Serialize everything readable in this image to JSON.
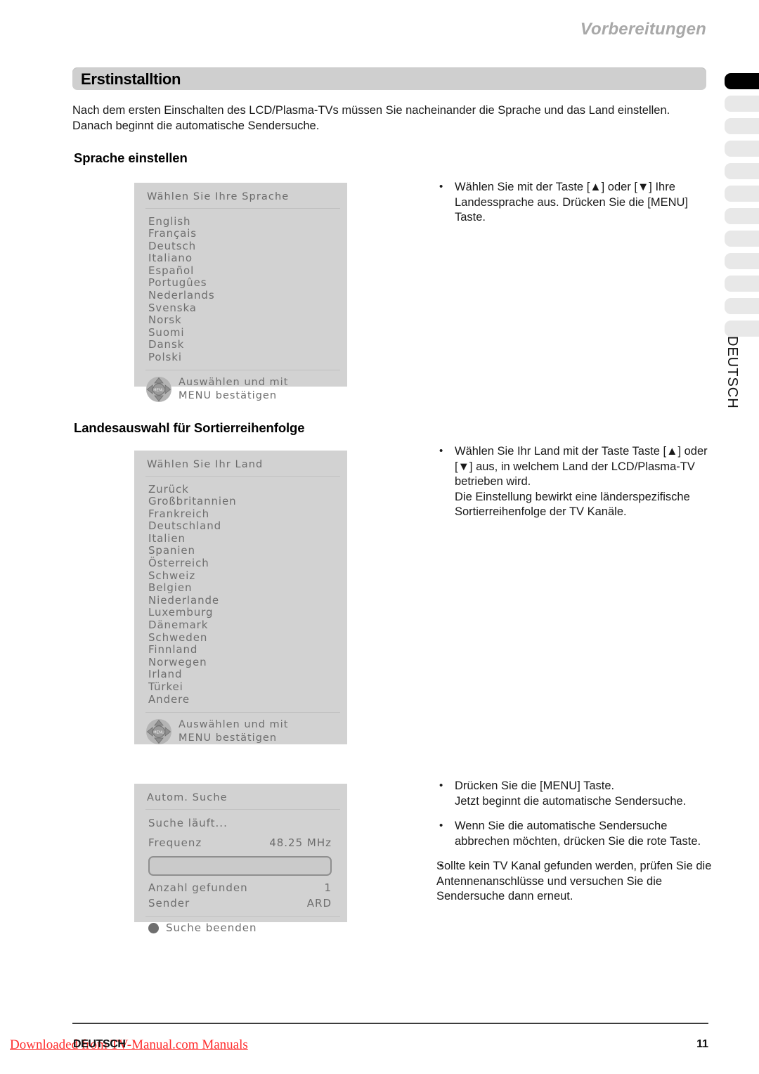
{
  "header": {
    "chapter": "Vorbereitungen",
    "title": "Erstinstalltion"
  },
  "sidebar": {
    "label": "DEUTSCH",
    "tabs": [
      {
        "state": "active"
      },
      {
        "state": "inactive"
      },
      {
        "state": "inactive"
      },
      {
        "state": "inactive"
      },
      {
        "state": "inactive"
      },
      {
        "state": "inactive"
      },
      {
        "state": "inactive"
      },
      {
        "state": "inactive"
      },
      {
        "state": "inactive"
      },
      {
        "state": "inactive"
      },
      {
        "state": "inactive"
      },
      {
        "state": "inactive"
      }
    ]
  },
  "intro": "Nach dem ersten Einschalten des LCD/Plasma-TVs müssen Sie nacheinander die Sprache und das Land einstellen. Danach beginnt die automatische Sendersuche.",
  "sections": {
    "language_heading": "Sprache einstellen",
    "country_heading": "Landesauswahl für Sortierreihenfolge"
  },
  "osd_language": {
    "title": "Wählen Sie Ihre Sprache",
    "items": [
      "English",
      "Français",
      "Deutsch",
      "Italiano",
      "Español",
      "Portugûes",
      "Nederlands",
      "Svenska",
      "Norsk",
      "Suomi",
      "Dansk",
      "Polski"
    ],
    "footer_line1": "Auswählen und mit",
    "footer_line2": "MENU bestätigen",
    "dpad_center_label": "MENU"
  },
  "osd_country": {
    "title": "Wählen Sie Ihr Land",
    "items": [
      "Zurück",
      "Großbritannien",
      "Frankreich",
      "Deutschland",
      "Italien",
      "Spanien",
      "Österreich",
      "Schweiz",
      "Belgien",
      "Niederlande",
      "Luxemburg",
      "Dänemark",
      "Schweden",
      "Finnland",
      "Norwegen",
      "Irland",
      "Türkei",
      "Andere"
    ],
    "footer_line1": "Auswählen und mit",
    "footer_line2": "MENU bestätigen",
    "dpad_center_label": "MENU"
  },
  "osd_search": {
    "title": "Autom. Suche",
    "status": "Suche läuft...",
    "frequency_label": "Frequenz",
    "frequency_value": "48.25 MHz",
    "progress_percent": 0,
    "found_label": "Anzahl gefunden",
    "found_value": "1",
    "station_label": "Sender",
    "station_value": "ARD",
    "stop_label": "Suche beenden"
  },
  "notes": {
    "language": [
      "Wählen Sie mit der Taste [▲] oder [▼] Ihre Landessprache aus. Drücken Sie die [MENU] Taste."
    ],
    "country": [
      "Wählen Sie Ihr Land mit der Taste Taste [▲] oder [▼] aus, in welchem Land der LCD/Plasma-TV betrieben wird.\nDie Einstellung bewirkt eine länderspezifische Sortierreihenfolge der TV Kanäle."
    ],
    "search_bullet1": "Drücken Sie die [MENU] Taste.\nJetzt beginnt die automatische Sendersuche.",
    "search_bullet2": "Wenn Sie die automatische Sendersuche abbrechen möchten, drücken Sie die rote Taste.",
    "search_para": "Sollte kein TV Kanal gefunden werden, prüfen Sie die Antennenanschlüsse und versuchen Sie die Sendersuche dann erneut."
  },
  "footer": {
    "language": "DEUTSCH",
    "page_number": "11",
    "watermark": "Downloaded from TV-Manual.com Manuals"
  },
  "colors": {
    "osd_background": "#d2d2d2",
    "osd_text": "#6e6e6e",
    "title_bar": "#cfcfcf",
    "chapter_text": "#a8a8a8",
    "tab_active": "#000000",
    "tab_inactive": "#e8e8e8",
    "watermark": "#ff2d2d"
  }
}
